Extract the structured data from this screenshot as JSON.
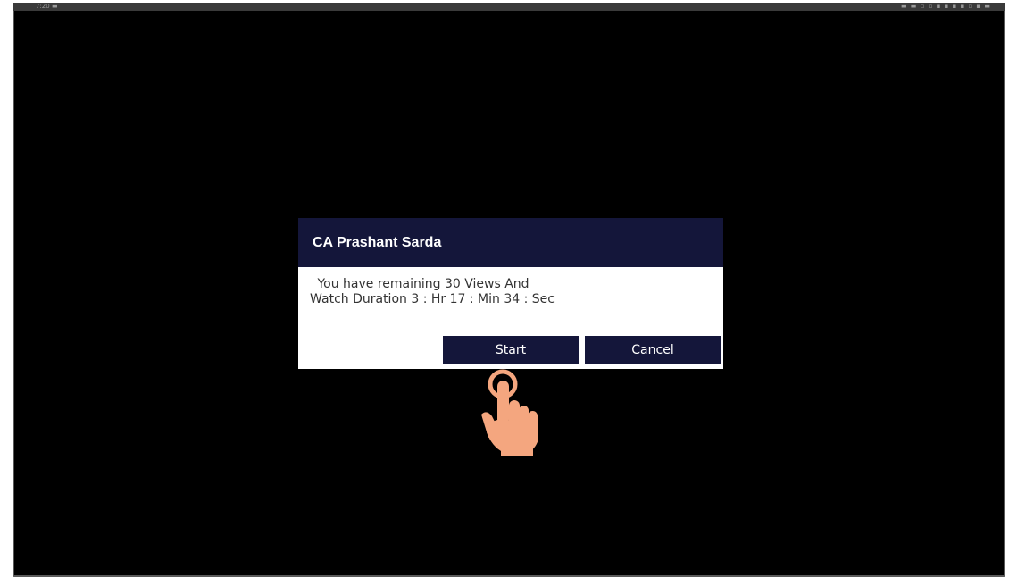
{
  "status_bar": {
    "time": "7:20 ▬",
    "icons": "▬ ▬ ▫ ▫ ▪ ▪ ▪ ▪ ▫ ▪ ▬"
  },
  "dialog": {
    "title": "CA Prashant Sarda",
    "message_line1": "You have remaining 30 Views And",
    "message_line2": "Watch Duration 3 : Hr 17 : Min 34 : Sec",
    "start_label": "Start",
    "cancel_label": "Cancel"
  },
  "colors": {
    "dialog_header": "#14163a",
    "button": "#14163a",
    "screen_bg": "#000000",
    "hand_fill": "#f4a67f"
  },
  "overlay": {
    "icon": "tap-hand-icon"
  }
}
